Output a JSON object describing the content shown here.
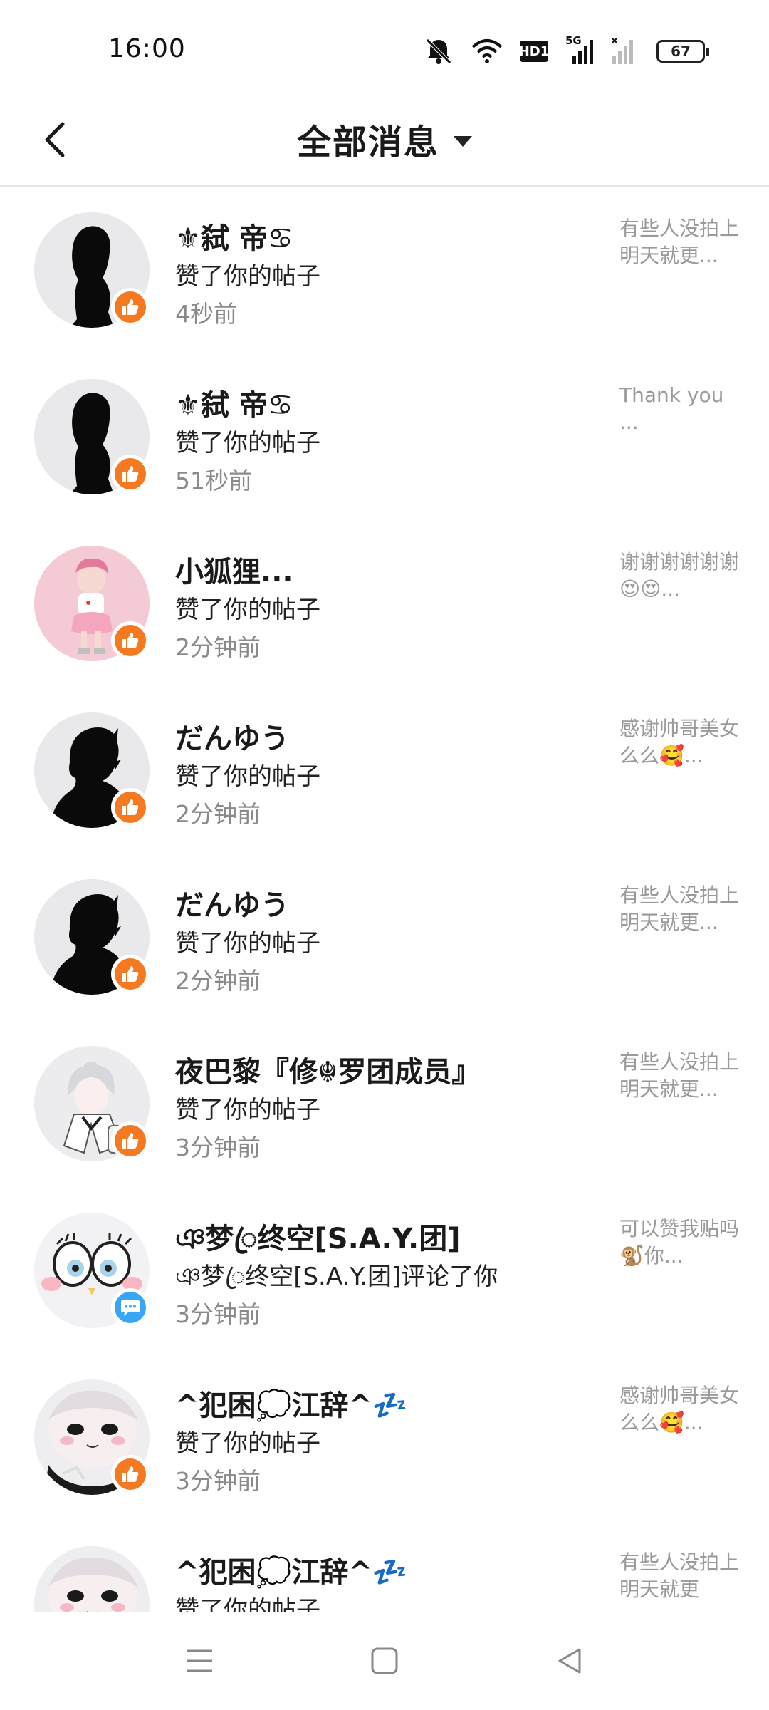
{
  "status_bar": {
    "time": "16:00",
    "hd_label": "HD1",
    "network_label": "5G",
    "battery": "67",
    "icons": [
      "mute-bell-icon",
      "wifi-icon",
      "hd-icon",
      "signal-5g-icon",
      "signal-icon",
      "battery-icon"
    ]
  },
  "header": {
    "back_icon": "back-arrow-icon",
    "title": "全部消息",
    "dropdown_icon": "caret-down-icon"
  },
  "notifications": [
    {
      "name": "⚜弑 帝♋",
      "action": "赞了你的帖子",
      "time": "4秒前",
      "preview": "有些人没拍上明天就更...",
      "type": "like",
      "avatar": "black-silhouette-girl"
    },
    {
      "name": "⚜弑 帝♋",
      "action": "赞了你的帖子",
      "time": "51秒前",
      "preview": "Thank you ...",
      "type": "like",
      "avatar": "black-silhouette-girl"
    },
    {
      "name": "小狐狸...",
      "action": "赞了你的帖子",
      "time": "2分钟前",
      "preview": "谢谢谢谢谢谢😍😍...",
      "type": "like",
      "avatar": "pink-anime-character"
    },
    {
      "name": "だんゆう",
      "action": "赞了你的帖子",
      "time": "2分钟前",
      "preview": "感谢帅哥美女么么🥰...",
      "type": "like",
      "avatar": "black-silhouette-boy"
    },
    {
      "name": "だんゆう",
      "action": "赞了你的帖子",
      "time": "2分钟前",
      "preview": "有些人没拍上明天就更...",
      "type": "like",
      "avatar": "black-silhouette-boy"
    },
    {
      "name": "夜巴黎『修☬罗团成员』",
      "action": "赞了你的帖子",
      "time": "3分钟前",
      "preview": "有些人没拍上明天就更...",
      "type": "like",
      "avatar": "white-hair-anime-girl"
    },
    {
      "name": "ঞ梦ꦿ终空[S.A.Y.团]",
      "action": "ঞ梦ꦿ终空[S.A.Y.团]评论了你",
      "time": "3分钟前",
      "preview": "可以赞我贴吗🐒你...",
      "type": "comment",
      "avatar": "cartoon-eyes-face"
    },
    {
      "name": "^犯困💭江辞^💤",
      "action": "赞了你的帖子",
      "time": "3分钟前",
      "preview": "感谢帅哥美女么么🥰...",
      "type": "like",
      "avatar": "pale-anime-face"
    },
    {
      "name": "^犯困💭江辞^💤",
      "action": "赞了你的帖子",
      "time": "",
      "preview": "有些人没拍上明天就更",
      "type": "like",
      "avatar": "pale-anime-face"
    }
  ],
  "nav_bar": {
    "icons": [
      "menu-icon",
      "home-square-icon",
      "back-triangle-icon"
    ]
  }
}
